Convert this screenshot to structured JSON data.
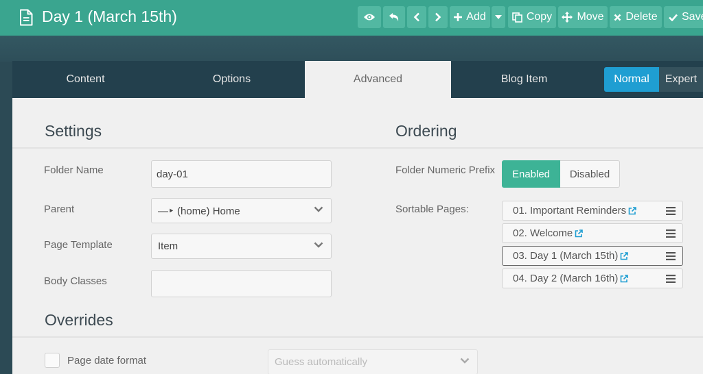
{
  "header": {
    "title": "Day 1 (March 15th)",
    "buttons": {
      "add": "Add",
      "copy": "Copy",
      "move": "Move",
      "delete": "Delete",
      "save": "Save"
    }
  },
  "tabs": {
    "content": "Content",
    "options": "Options",
    "advanced": "Advanced",
    "blog_item": "Blog Item",
    "active": "Advanced"
  },
  "mode": {
    "normal": "Normal",
    "expert": "Expert",
    "selected": "Normal"
  },
  "settings": {
    "title": "Settings",
    "folder_name": {
      "label": "Folder Name",
      "value": "day-01"
    },
    "parent": {
      "label": "Parent",
      "value": "—‣ (home) Home"
    },
    "page_template": {
      "label": "Page Template",
      "value": "Item"
    },
    "body_classes": {
      "label": "Body Classes",
      "value": ""
    }
  },
  "ordering": {
    "title": "Ordering",
    "folder_numeric_prefix": {
      "label": "Folder Numeric Prefix",
      "enabled": "Enabled",
      "disabled": "Disabled",
      "selected": "Enabled"
    },
    "sortable_pages": {
      "label": "Sortable Pages:",
      "items": [
        "01. Important Reminders",
        "02. Welcome",
        "03. Day 1 (March 15th)",
        "04. Day 2 (March 16th)"
      ],
      "current_index": 2
    }
  },
  "overrides": {
    "title": "Overrides",
    "page_date_format": {
      "label": "Page date format",
      "checked": false,
      "value": "Guess automatically"
    }
  },
  "colors": {
    "header_bg": "#3aa58f",
    "button_bg": "#52b8a2",
    "tabs_bg": "#23404d",
    "accent_blue": "#1f9ed2",
    "enabled_green": "#3db396",
    "link_blue": "#1f9ed2"
  },
  "icons": {
    "page": "document-icon",
    "preview": "eye-icon",
    "revert": "undo-icon",
    "prev": "chevron-left-icon",
    "next": "chevron-right-icon",
    "add": "plus-icon",
    "dropdown": "caret-down-icon",
    "copy": "copy-icon",
    "move": "move-arrows-icon",
    "delete": "close-icon",
    "save": "check-icon",
    "external": "external-link-icon",
    "drag": "drag-handle-icon"
  }
}
